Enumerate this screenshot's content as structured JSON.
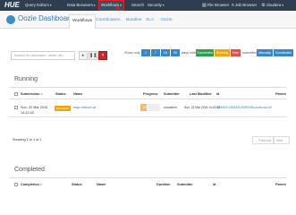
{
  "topnav": {
    "logo": "HUE",
    "items": [
      "Query Editors",
      "Data Browsers",
      "Workflows",
      "Search",
      "Security",
      "File Browser",
      "Job Browser",
      "cloudera"
    ],
    "active": "Workflows"
  },
  "subheader": {
    "title": "Oozie Dashboard",
    "tabs": [
      "Workflows",
      "Coordinators",
      "Bundles",
      "SLA",
      "Oozie"
    ],
    "active_tab": "Workflows"
  },
  "filter": {
    "search_placeholder": "Search for username, name, etc...",
    "show_only_label": "Show only",
    "days": [
      "1",
      "7",
      "15",
      "30"
    ],
    "days_label": "days with status",
    "statuses": [
      "Succeeded",
      "Running",
      "Error"
    ],
    "submitted_label": "submitted",
    "submitted_buttons": [
      "Manually",
      "Coordinator"
    ]
  },
  "running": {
    "title": "Running",
    "columns": [
      "Submission",
      "Status",
      "Name",
      "Progress",
      "Submitter",
      "Last Modified",
      "Id",
      "Parent"
    ],
    "rows": [
      {
        "submission": "Sun, 22 Mar 2015 14:22:32",
        "status": "RUNNING",
        "name": "map-reduce-wf",
        "progress_pct": 33,
        "progress_text": "33%",
        "submitter": "cloudera",
        "last_modified": "Sun, 22 Mar 2015 14:22:32",
        "id": "0000000-150322124350245-oozie-oozi-W",
        "parent": ""
      }
    ],
    "showing": "Showing 1 to 1 of 1",
    "pager_prev": "← Previous",
    "pager_next": "Next →"
  },
  "completed": {
    "title": "Completed",
    "columns": [
      "Completion",
      "Status",
      "Name",
      "Duration",
      "Submitter",
      "Id",
      "Parent"
    ]
  },
  "colors": {
    "nav_bg": "#2d3e50",
    "accent": "#3a87c8",
    "succeeded": "#2e9e4f",
    "running": "#f0a30a",
    "error": "#d9534f",
    "highlight": "#e0202a"
  }
}
